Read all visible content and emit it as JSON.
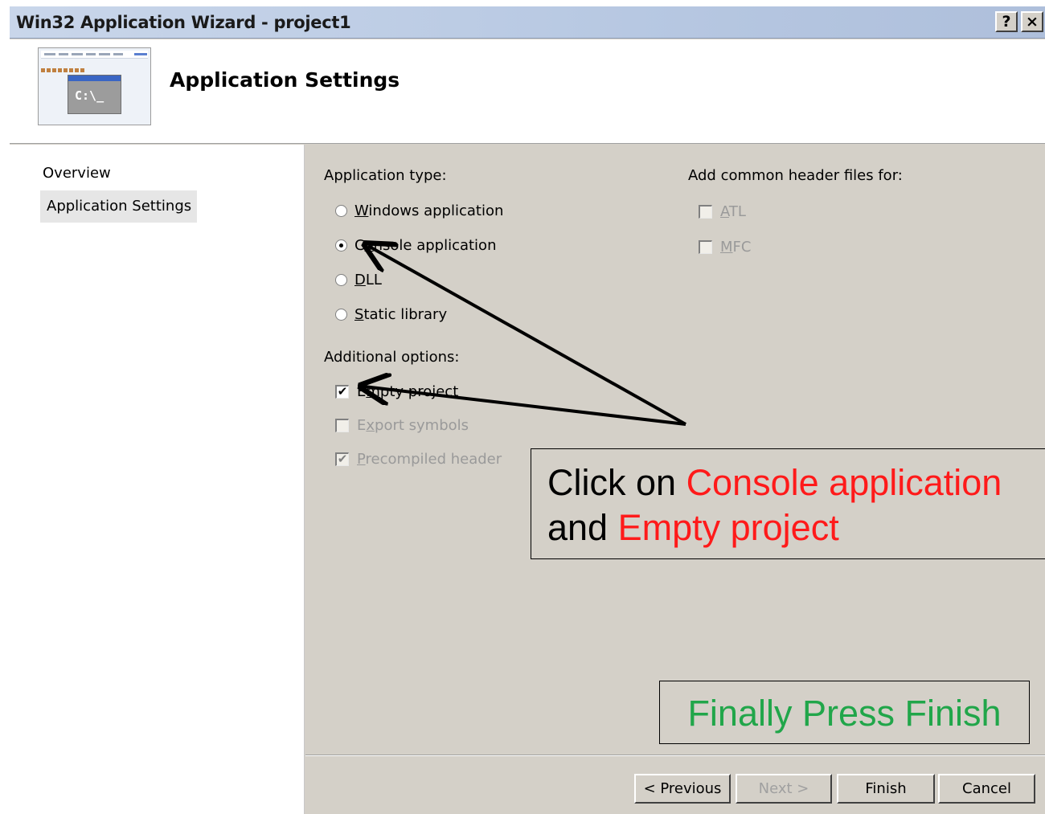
{
  "window": {
    "title": "Win32 Application Wizard - project1",
    "help_button": "?",
    "close_button": "×"
  },
  "header": {
    "title": "Application Settings",
    "icon_text": "C:\\_"
  },
  "nav": {
    "items": [
      {
        "label": "Overview",
        "selected": false
      },
      {
        "label": "Application Settings",
        "selected": true
      }
    ]
  },
  "app_type": {
    "label": "Application type:",
    "options": [
      {
        "pre": "",
        "ul": "W",
        "post": "indows application",
        "checked": false
      },
      {
        "pre": "C",
        "ul": "o",
        "post": "nsole application",
        "checked": true
      },
      {
        "pre": "",
        "ul": "D",
        "post": "LL",
        "checked": false
      },
      {
        "pre": "",
        "ul": "S",
        "post": "tatic library",
        "checked": false
      }
    ]
  },
  "additional": {
    "label": "Additional options:",
    "options": [
      {
        "pre": "E",
        "ul": "m",
        "post": "pty project",
        "checked": true,
        "enabled": true
      },
      {
        "pre": "E",
        "ul": "x",
        "post": "port symbols",
        "checked": false,
        "enabled": false
      },
      {
        "pre": "",
        "ul": "P",
        "post": "recompiled header",
        "checked": true,
        "enabled": false
      }
    ]
  },
  "headers": {
    "label": "Add common header files for:",
    "options": [
      {
        "pre": "",
        "ul": "A",
        "post": "TL",
        "checked": false,
        "enabled": false
      },
      {
        "pre": "",
        "ul": "M",
        "post": "FC",
        "checked": false,
        "enabled": false
      }
    ]
  },
  "buttons": {
    "previous": "< Previous",
    "next": "Next >",
    "finish": "Finish",
    "cancel": "Cancel"
  },
  "annotations": {
    "callout1_a": "Click on ",
    "callout1_b": "Console application",
    "callout1_c": "and ",
    "callout1_d": "Empty project",
    "callout2": "Finally Press Finish",
    "highlight_red": "#ff1a1a",
    "highlight_green": "#21a64a"
  },
  "colors": {
    "dialog_bg": "#d4d0c8",
    "titlebar": "#b7c8e2"
  }
}
